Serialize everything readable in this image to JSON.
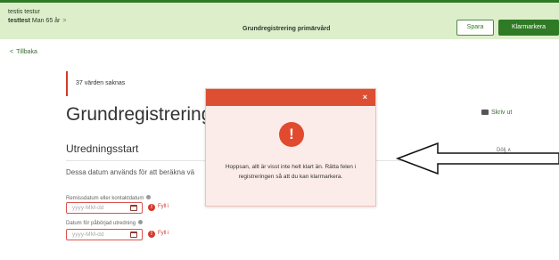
{
  "header": {
    "patient_name": "testis testur",
    "patient_id": "testtest",
    "patient_meta": "Man 65 år",
    "chevron": ">",
    "title": "Grundregistrering primärvård",
    "save_label": "Spara",
    "complete_label": "Klarmarkera"
  },
  "nav": {
    "back_chevron": "<",
    "back_label": "Tillbaka"
  },
  "warning": {
    "text": "37 värden saknas"
  },
  "page": {
    "title": "Grundregistrering",
    "print_label": "Skriv ut"
  },
  "section": {
    "title": "Utredningsstart",
    "collapse_label": "Dölj ∧",
    "description": "Dessa datum används för att beräkna vä"
  },
  "fields": [
    {
      "label": "Remissdatum eller kontaktdatum",
      "placeholder": "yyyy-MM-dd",
      "hint": "Fyll i"
    },
    {
      "label": "Datum för påbörjad utredning",
      "placeholder": "yyyy-MM-dd",
      "hint": "Fyll i"
    }
  ],
  "modal": {
    "close_glyph": "×",
    "icon_glyph": "!",
    "message": "Hoppsan, allt är visst inte helt klart än. Rätta felen i registreringen så att du kan klarmarkera."
  },
  "colors": {
    "header_bg": "#ddeecb",
    "brand_green": "#2f7a25",
    "error_red": "#d23b2b",
    "modal_bar": "#dc4f32",
    "modal_bg": "#fcece9"
  },
  "icons": {
    "warning": "exclamation-circle-icon",
    "print": "printer-icon",
    "calendar": "calendar-icon",
    "help": "question-icon"
  }
}
